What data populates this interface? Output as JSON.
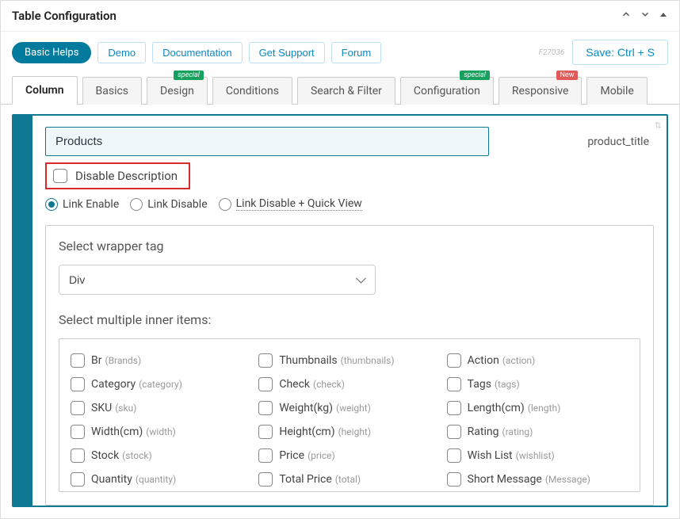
{
  "panel": {
    "title": "Table Configuration"
  },
  "toolbar": {
    "basic_helps": "Basic Helps",
    "demo": "Demo",
    "documentation": "Documentation",
    "get_support": "Get Support",
    "forum": "Forum",
    "code": "F27036",
    "save": "Save: Ctrl + S"
  },
  "tabs": [
    {
      "label": "Column",
      "active": true
    },
    {
      "label": "Basics"
    },
    {
      "label": "Design",
      "badge": "special",
      "badge_type": "special"
    },
    {
      "label": "Conditions"
    },
    {
      "label": "Search & Filter"
    },
    {
      "label": "Configuration",
      "badge": "special",
      "badge_type": "special"
    },
    {
      "label": "Responsive",
      "badge": "New",
      "badge_type": "new"
    },
    {
      "label": "Mobile"
    }
  ],
  "config": {
    "field_value": "Products",
    "field_slug": "product_title",
    "disable_description": "Disable Description",
    "radios": [
      {
        "label": "Link Enable",
        "checked": true,
        "dotted": false
      },
      {
        "label": "Link Disable",
        "checked": false,
        "dotted": false
      },
      {
        "label": "Link Disable + Quick View",
        "checked": false,
        "dotted": true
      }
    ],
    "wrapper_label": "Select wrapper tag",
    "wrapper_value": "Div",
    "inner_label": "Select multiple inner items:",
    "items": [
      {
        "label": "Br",
        "slug": "(Brands)"
      },
      {
        "label": "Thumbnails",
        "slug": "(thumbnails)"
      },
      {
        "label": "Action",
        "slug": "(action)"
      },
      {
        "label": "Category",
        "slug": "(category)"
      },
      {
        "label": "Check",
        "slug": "(check)"
      },
      {
        "label": "Tags",
        "slug": "(tags)"
      },
      {
        "label": "SKU",
        "slug": "(sku)"
      },
      {
        "label": "Weight(kg)",
        "slug": "(weight)"
      },
      {
        "label": "Length(cm)",
        "slug": "(length)"
      },
      {
        "label": "Width(cm)",
        "slug": "(width)"
      },
      {
        "label": "Height(cm)",
        "slug": "(height)"
      },
      {
        "label": "Rating",
        "slug": "(rating)"
      },
      {
        "label": "Stock",
        "slug": "(stock)"
      },
      {
        "label": "Price",
        "slug": "(price)"
      },
      {
        "label": "Wish List",
        "slug": "(wishlist)"
      },
      {
        "label": "Quantity",
        "slug": "(quantity)"
      },
      {
        "label": "Total Price",
        "slug": "(total)"
      },
      {
        "label": "Short Message",
        "slug": "(Message)"
      }
    ]
  }
}
